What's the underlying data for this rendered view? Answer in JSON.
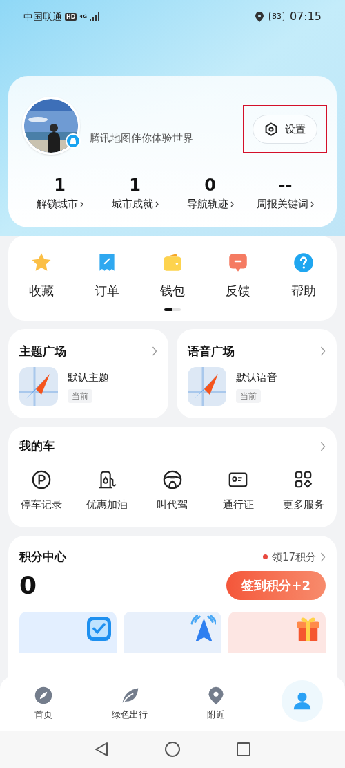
{
  "status_bar": {
    "carrier": "中国联通",
    "hd": "HD",
    "network": "4G",
    "battery": "83",
    "time": "07:15"
  },
  "profile": {
    "tagline": "腾讯地图伴你体验世界",
    "settings_button": {
      "label": "设置",
      "highlighted": true
    },
    "stats": [
      {
        "value": "1",
        "label": "解锁城市"
      },
      {
        "value": "1",
        "label": "城市成就"
      },
      {
        "value": "0",
        "label": "导航轨迹"
      },
      {
        "value": "--",
        "label": "周报关键词"
      }
    ]
  },
  "shortcuts": {
    "items": [
      {
        "kind": "star",
        "label": "收藏"
      },
      {
        "kind": "order",
        "label": "订单"
      },
      {
        "kind": "wallet",
        "label": "钱包"
      },
      {
        "kind": "feedback",
        "label": "反馈"
      },
      {
        "kind": "help",
        "label": "帮助"
      }
    ],
    "pages": [
      {
        "selected": true
      },
      {
        "selected": false
      }
    ]
  },
  "plazas": [
    {
      "title": "主题广场",
      "item": "默认主题",
      "tag": "当前"
    },
    {
      "title": "语音广场",
      "item": "默认语音",
      "tag": "当前"
    }
  ],
  "my_car": {
    "title": "我的车",
    "items": [
      {
        "kind": "parking",
        "label": "停车记录"
      },
      {
        "kind": "fuel",
        "label": "优惠加油"
      },
      {
        "kind": "wheel",
        "label": "叫代驾"
      },
      {
        "kind": "pass",
        "label": "通行证"
      },
      {
        "kind": "more",
        "label": "更多服务"
      }
    ]
  },
  "points": {
    "title": "积分中心",
    "reward": "领17积分",
    "score": "0",
    "checkin_button": "签到积分+2",
    "task_cards": [
      {
        "kind": "check",
        "color": "#e3efff"
      },
      {
        "kind": "arrow",
        "color": "#e8f0fb"
      },
      {
        "kind": "gift",
        "color": "#fde6e3"
      }
    ]
  },
  "tab_bar": [
    {
      "kind": "compass",
      "label": "首页",
      "selected": false
    },
    {
      "kind": "leaf",
      "label": "绿色出行",
      "selected": false
    },
    {
      "kind": "pin",
      "label": "附近",
      "selected": false
    },
    {
      "kind": "person",
      "selected": true
    }
  ]
}
